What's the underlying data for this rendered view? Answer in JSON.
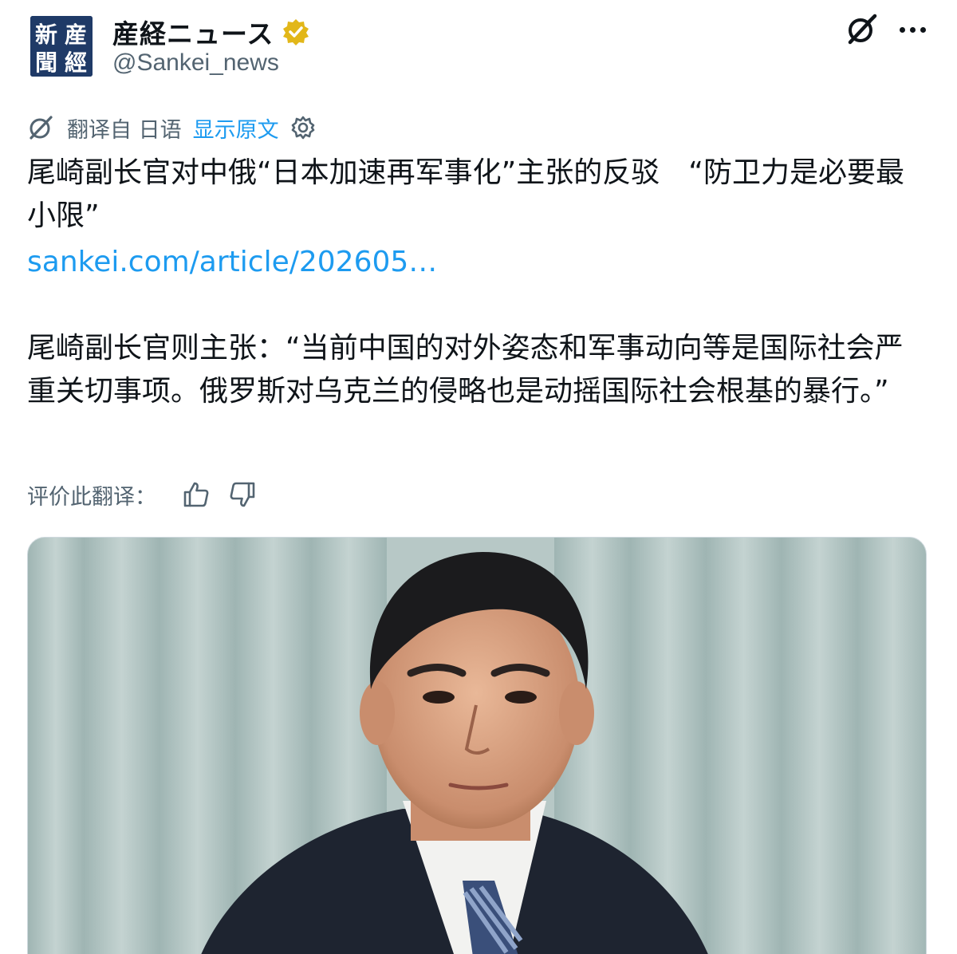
{
  "account": {
    "display_name": "産経ニュース",
    "handle": "@Sankei_news",
    "verified": true,
    "avatar_text": [
      "産",
      "經",
      "新",
      "聞"
    ]
  },
  "translate": {
    "translated_from": "翻译自 日语",
    "show_original": "显示原文"
  },
  "tweet": {
    "headline": "尾崎副长官对中俄“日本加速再军事化”主张的反驳　“防卫力是必要最小限”",
    "link": "sankei.com/article/202605…",
    "body": "尾崎副长官则主张：“当前中国的对外姿态和军事动向等是国际社会严重关切事项。俄罗斯对乌克兰的侵略也是动摇国际社会根基的暴行。”"
  },
  "rating": {
    "label": "评价此翻译："
  },
  "colors": {
    "link": "#1d9bf0",
    "verified_gold": "#e2b719",
    "muted": "#536471",
    "avatar_bg": "#1f3a67"
  },
  "icons": [
    "grok-icon",
    "more-icon",
    "verified-badge-icon",
    "translate-icon",
    "gear-icon",
    "thumbs-up-icon",
    "thumbs-down-icon"
  ]
}
